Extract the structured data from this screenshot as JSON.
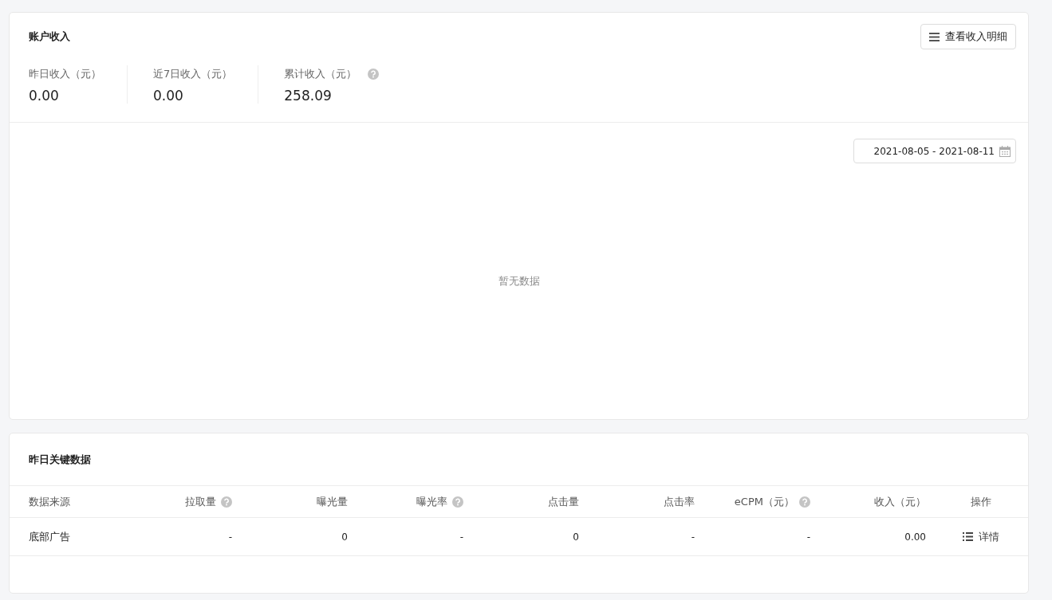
{
  "income_card": {
    "title": "账户收入",
    "detail_button": "查看收入明细",
    "stats": [
      {
        "label": "昨日收入（元）",
        "value": "0.00",
        "help": false
      },
      {
        "label": "近7日收入（元）",
        "value": "0.00",
        "help": false
      },
      {
        "label": "累计收入（元）",
        "value": "258.09",
        "help": true
      }
    ],
    "date_range": "2021-08-05 - 2021-08-11",
    "empty_text": "暂无数据"
  },
  "key_data_card": {
    "title": "昨日关键数据",
    "columns": [
      {
        "label": "数据来源",
        "help": false
      },
      {
        "label": "拉取量",
        "help": true
      },
      {
        "label": "曝光量",
        "help": false
      },
      {
        "label": "曝光率",
        "help": true
      },
      {
        "label": "点击量",
        "help": false
      },
      {
        "label": "点击率",
        "help": false
      },
      {
        "label": "eCPM（元）",
        "help": true
      },
      {
        "label": "收入（元）",
        "help": false
      },
      {
        "label": "操作",
        "help": false
      }
    ],
    "rows": [
      {
        "cells": [
          "底部广告",
          "-",
          "0",
          "-",
          "0",
          "-",
          "-",
          "0.00"
        ],
        "action": "详情"
      }
    ]
  }
}
